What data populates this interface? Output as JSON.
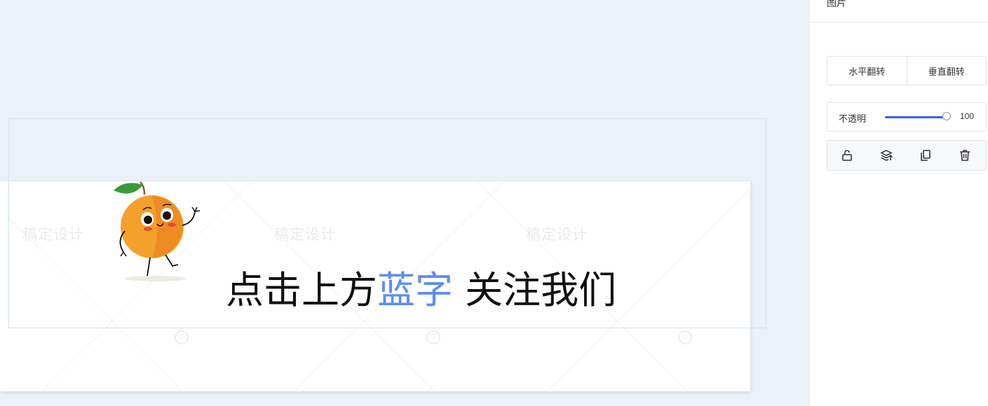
{
  "panel": {
    "title": "图片",
    "flip_horizontal_label": "水平翻转",
    "flip_vertical_label": "垂直翻转",
    "opacity_label": "不透明",
    "opacity_value": "100",
    "opacity_fraction": 1.0,
    "tools": [
      {
        "icon": "unlock-icon"
      },
      {
        "icon": "layer-order-icon"
      },
      {
        "icon": "copy-icon"
      },
      {
        "icon": "trash-icon"
      }
    ]
  },
  "canvas": {
    "watermark_text": "稿定设计",
    "headline_part1": "点击上方",
    "headline_blue": "蓝字",
    "headline_part2": " 关注我们"
  },
  "colors": {
    "accent_blue": "#5e8cf3",
    "slider_blue": "#3a63e8",
    "background": "#ecf0f8"
  }
}
